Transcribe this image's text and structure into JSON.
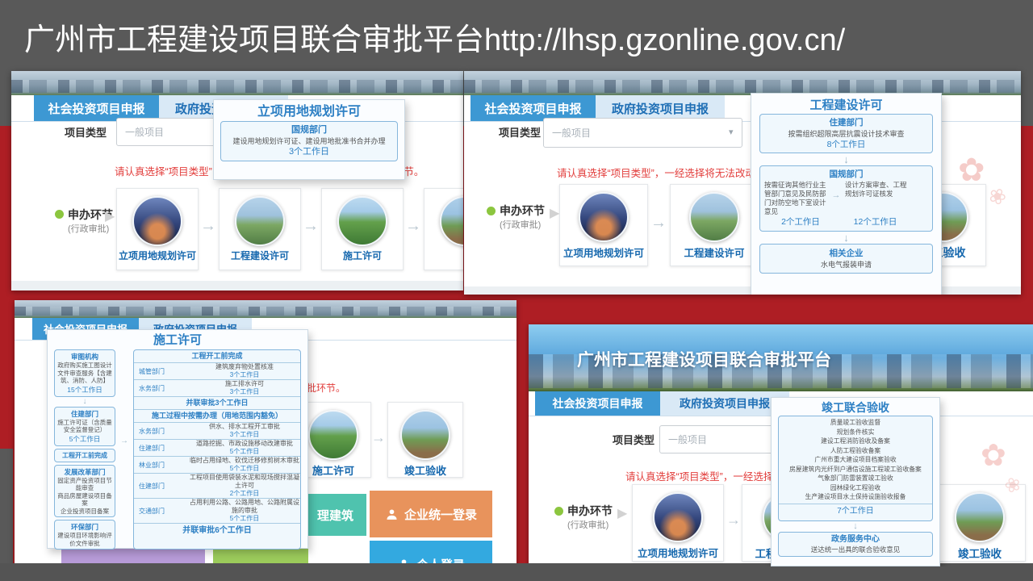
{
  "slide": {
    "header_title": "广州市工程建设项目联合审批平台http://lhsp.gzonline.gov.cn/",
    "colors": {
      "header_bg": "#595959",
      "red_bg": "#AE1E24",
      "accent_blue": "#3D98D3",
      "warning_red": "#E23E3C"
    }
  },
  "common": {
    "tab_social": "社会投资项目申报",
    "tab_government": "政府投资项目申报",
    "project_type_label": "项目类型",
    "project_type_value": "一般项目",
    "warning": "请认真选择“项目类型”，一经选择将无法改动，并影响后续审批环节。",
    "warning_tail": "审批环节。",
    "steps_label": "申办环节",
    "steps_sub": "(行政审批)",
    "step1": "立项用地规划许可",
    "step2": "工程建设许可",
    "step3": "施工许可",
    "step4": "竣工验收"
  },
  "shot1": {
    "popup": {
      "title": "立项用地规划许可",
      "dept": "国规部门",
      "desc": "建设用地规划许可证、建设用地批准书合并办理",
      "days": "3个工作日"
    }
  },
  "shot2": {
    "popup": {
      "title": "工程建设许可",
      "box1": {
        "dept": "住建部门",
        "desc": "按需组织超限高层抗震设计技术审查",
        "days": "8个工作日"
      },
      "box2": {
        "dept": "国规部门",
        "left_desc": "按需征询其他行业主管部门意见及民防部门对防空地下室设计意见",
        "left_days": "2个工作日",
        "right_desc": "设计方案审查、工程规划许可证核发",
        "right_days": "12个工作日"
      },
      "box3": {
        "dept": "相关企业",
        "desc": "水电气报装申请"
      }
    }
  },
  "shot3": {
    "popup": {
      "title": "施工许可",
      "b1": {
        "dept": "审图机构",
        "desc": "政府购买施工图设计文件审查服务【含建筑、消防、人防】",
        "days": "15个工作日"
      },
      "b2": {
        "dept": "住建部门",
        "desc": "施工许可证（含质量安全监督登记）",
        "days": "5个工作日"
      },
      "b3_label": "工程开工前完成",
      "b4": {
        "dept": "发展改革部门",
        "line1": "固定资产投资项目节能审查",
        "line2": "商品房屋建设项目备案",
        "line3": "企业投资项目备案"
      },
      "b5": {
        "dept": "环保部门",
        "desc": "建设项目环境影响评价文件审批"
      },
      "right": {
        "h1": "工程开工前完成",
        "rows1": [
          {
            "dept": "城管部门",
            "desc": "建筑废弃物处置核准",
            "days": "3个工作日"
          },
          {
            "dept": "水务部门",
            "desc": "施工排水许可",
            "days": "3个工作日"
          }
        ],
        "f1": "并联审批3个工作日",
        "h2": "施工过程中按需办理（用地范围内豁免）",
        "rows2": [
          {
            "dept": "水务部门",
            "desc": "供水、排水工程开工审批",
            "days": "3个工作日"
          },
          {
            "dept": "住建部门",
            "desc": "道路挖掘、市政设施移动改建审批",
            "days": "5个工作日"
          },
          {
            "dept": "林业部门",
            "desc": "临时占用绿地、砍伐迁移修剪树木审批",
            "days": "5个工作日"
          },
          {
            "dept": "住建部门",
            "desc": "工程项目使用袋装水泥和现场搅拌混凝土许可",
            "days": "2个工作日"
          },
          {
            "dept": "交通部门",
            "desc": "占用利用公路、公路用地、公路附属设施的审批",
            "days": "5个工作日"
          }
        ],
        "f2": "并联审批6个工作日"
      },
      "buttons": {
        "teal_fragment": "理建筑",
        "orange": "企业统一登录",
        "blue": "个人登录"
      }
    }
  },
  "shot4": {
    "banner_title": "广州市工程建设项目联合审批平台",
    "popup": {
      "title": "竣工联合验收",
      "items": [
        "质量竣工验收监督",
        "规划条件核实",
        "建设工程消防验收及备案",
        "人防工程验收备案",
        "广州市重大建设项目档案验收",
        "房屋建筑内光纤到户通信设施工程竣工验收备案",
        "气象部门防雷装置竣工验收",
        "园林绿化工程验收",
        "生产建设项目水土保持设施验收报备"
      ],
      "days": "7个工作日",
      "center": "政务服务中心",
      "center_desc": "送达统一出具的联合验收意见"
    }
  }
}
